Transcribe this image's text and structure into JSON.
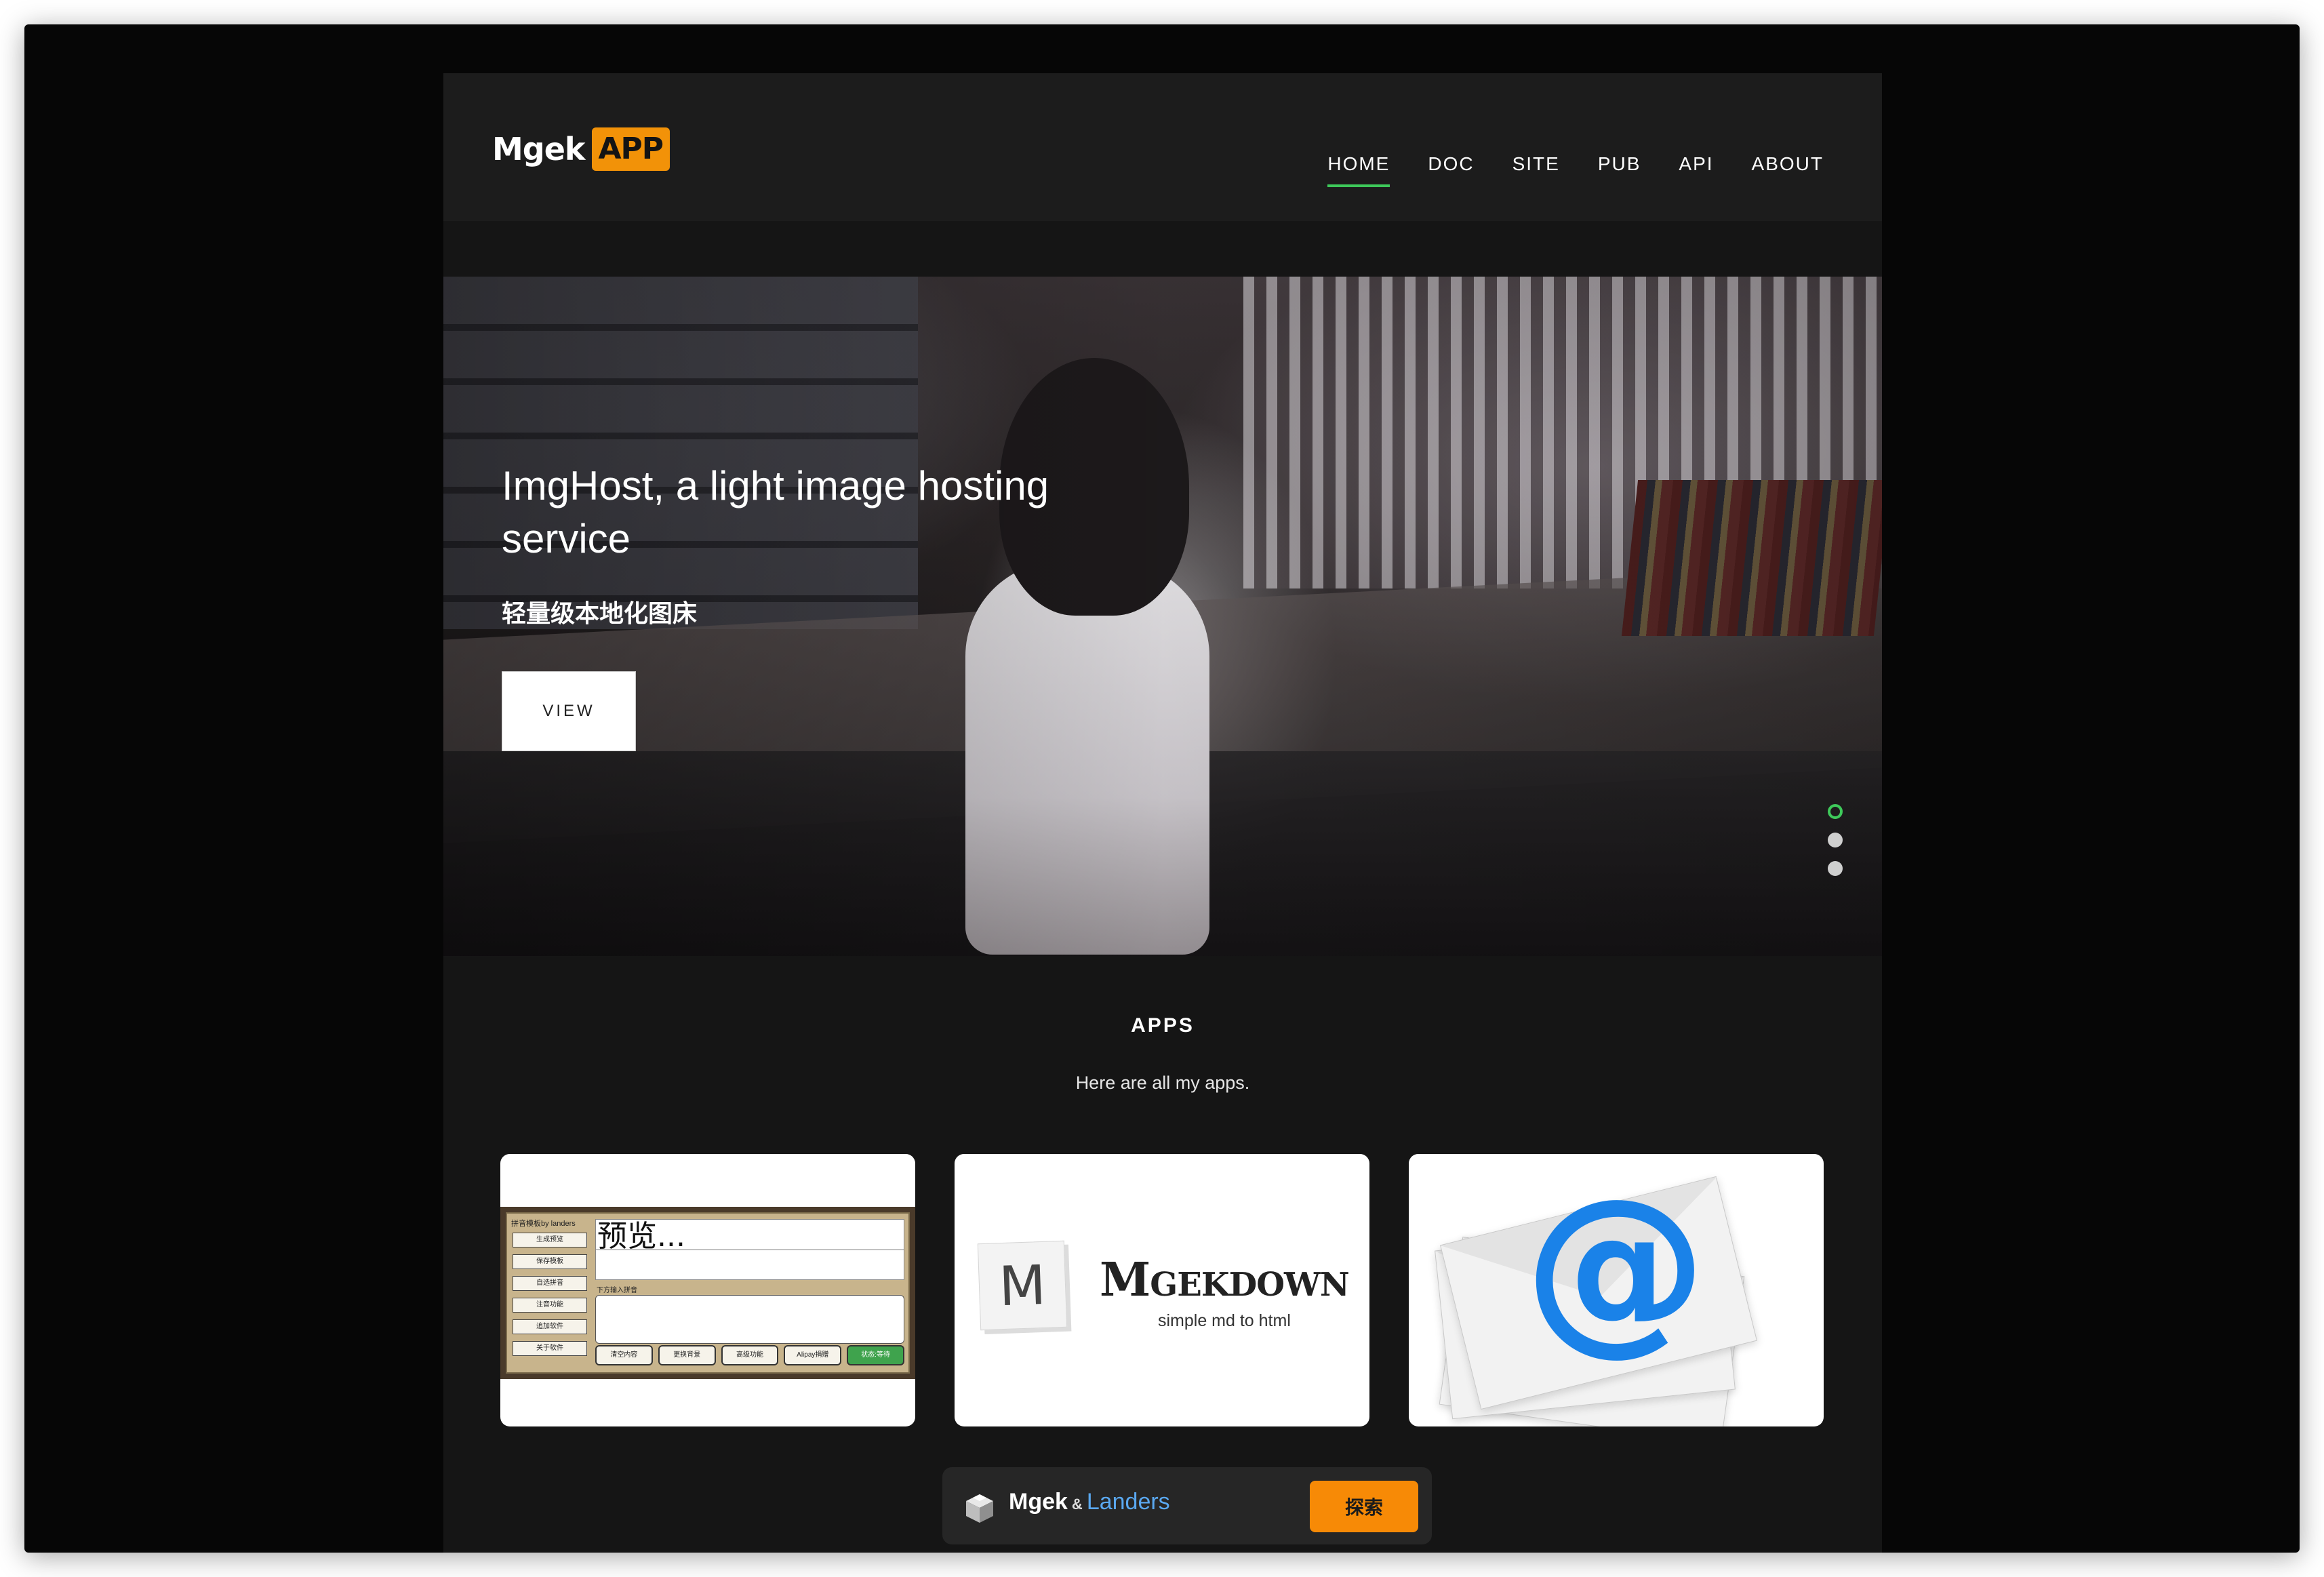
{
  "brand": {
    "name": "Mgek",
    "badge": "APP",
    "badge_color": "#f29208"
  },
  "nav": {
    "items": [
      {
        "label": "HOME",
        "active": true
      },
      {
        "label": "DOC",
        "active": false
      },
      {
        "label": "SITE",
        "active": false
      },
      {
        "label": "PUB",
        "active": false
      },
      {
        "label": "API",
        "active": false
      },
      {
        "label": "ABOUT",
        "active": false
      }
    ],
    "active_color": "#3ec95a"
  },
  "hero": {
    "title": "ImgHost, a light image hosting service",
    "subtitle": "轻量级本地化图床",
    "button_label": "VIEW",
    "slides": 3,
    "active_slide": 1
  },
  "apps": {
    "title": "APPS",
    "description": "Here are all my apps.",
    "cards": [
      {
        "icon": "pinyin-tool-screenshot",
        "mock": {
          "side_title": "拼音模板by landers",
          "side_buttons": [
            "生成预览",
            "保存模板",
            "自选拼音",
            "注音功能",
            "追加软件",
            "关于软件"
          ],
          "preview_text": "预览...",
          "input_label": "下方输入拼音",
          "actions": [
            "清空内容",
            "更换背景",
            "高级功能",
            "Alipay捐赠",
            "状态:等待"
          ]
        }
      },
      {
        "icon": "mgekdown-logo",
        "logo_letter": "M",
        "name": "Mgekdown",
        "tagline": "simple md to html"
      },
      {
        "icon": "email-envelopes-icon"
      }
    ]
  },
  "footer": {
    "brand": "Mgek",
    "amp": "&",
    "partner": "Landers",
    "button_label": "探索",
    "button_color": "#f78a06"
  }
}
